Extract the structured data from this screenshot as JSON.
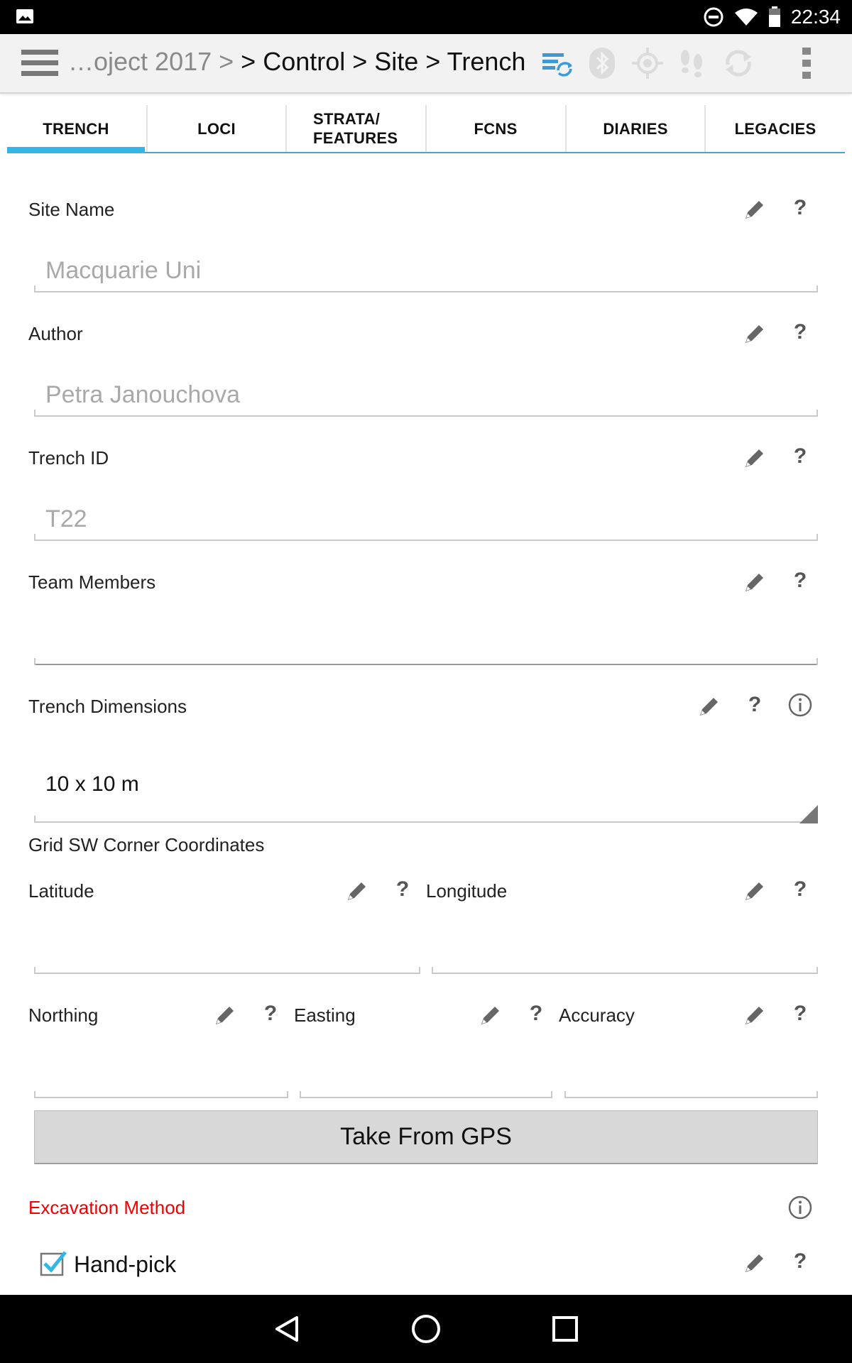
{
  "status_bar": {
    "time": "22:34"
  },
  "action_bar": {
    "breadcrumb_faded": "…oject 2017 >",
    "breadcrumb_main": "> Control > Site > Trench",
    "icons": [
      "menu-icon",
      "sync-icon",
      "bluetooth-icon",
      "gps-target-icon",
      "footsteps-icon",
      "refresh-icon",
      "overflow-menu-icon"
    ]
  },
  "tabs": [
    {
      "label": "TRENCH",
      "active": true
    },
    {
      "label": "LOCI",
      "active": false
    },
    {
      "label": "STRATA/ FEATURES",
      "active": false
    },
    {
      "label": "FCNS",
      "active": false
    },
    {
      "label": "DIARIES",
      "active": false
    },
    {
      "label": "LEGACIES",
      "active": false
    }
  ],
  "fields": {
    "site_name": {
      "label": "Site Name",
      "placeholder": "Macquarie Uni"
    },
    "author": {
      "label": "Author",
      "placeholder": "Petra Janouchova"
    },
    "trench_id": {
      "label": "Trench ID",
      "placeholder": "T22"
    },
    "team_members": {
      "label": "Team Members",
      "value": ""
    },
    "trench_dimensions": {
      "label": "Trench Dimensions",
      "value": "10 x 10 m"
    },
    "grid_heading": "Grid SW Corner Coordinates",
    "latitude": {
      "label": "Latitude",
      "value": ""
    },
    "longitude": {
      "label": "Longitude",
      "value": ""
    },
    "northing": {
      "label": "Northing",
      "value": ""
    },
    "easting": {
      "label": "Easting",
      "value": ""
    },
    "accuracy": {
      "label": "Accuracy",
      "value": ""
    },
    "gps_button": "Take From GPS",
    "excavation_method": {
      "label": "Excavation Method",
      "option": "Hand-pick",
      "checked": true
    }
  },
  "colors": {
    "accent": "#33b5e5",
    "required_label": "#f00000",
    "status_bar": "#000000"
  }
}
